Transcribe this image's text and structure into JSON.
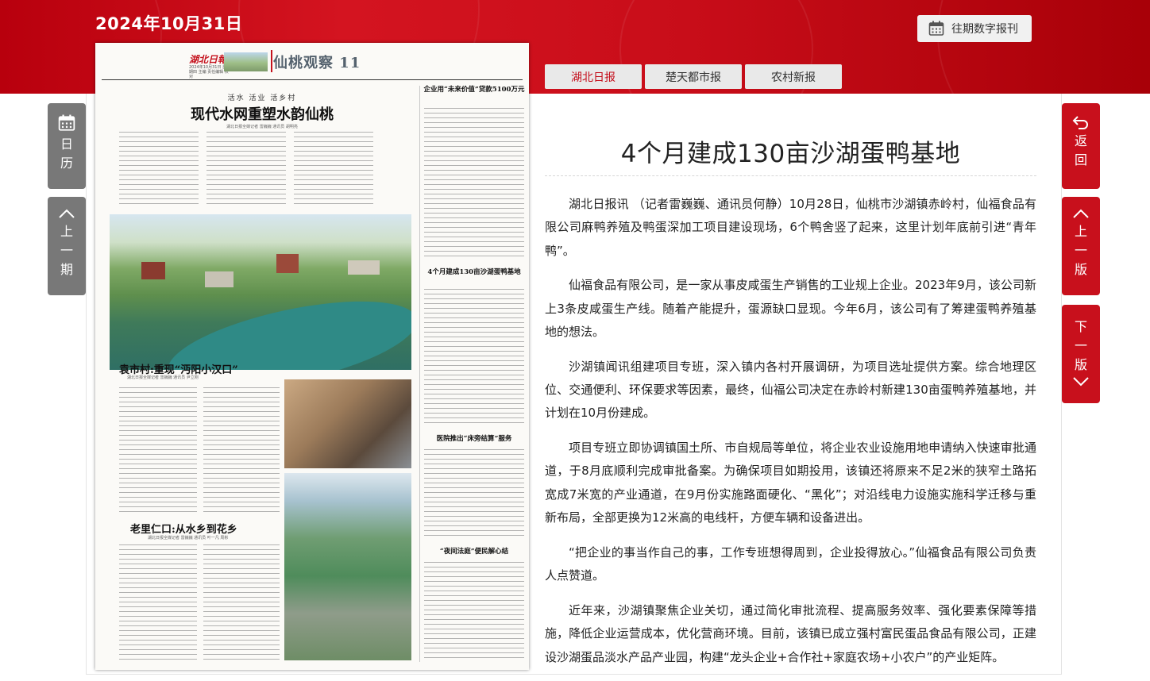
{
  "header": {
    "date": "2024年10月31日",
    "archive_button": "往期数字报刊"
  },
  "papers": [
    {
      "label": "湖北日报",
      "active": true
    },
    {
      "label": "楚天都市报",
      "active": false
    },
    {
      "label": "农村新报",
      "active": false
    }
  ],
  "nav": {
    "calendar": [
      "日",
      "历"
    ],
    "prev_issue": [
      "上",
      "一",
      "期"
    ],
    "prev_page": [
      "上",
      "一",
      "版"
    ],
    "next_page": [
      "下",
      "一",
      "版"
    ]
  },
  "newspaper": {
    "logo": "湖北日報",
    "meta": "2024年10月31日 星期四 主编 责任编辑 校对",
    "section": "仙桃观察 11",
    "kicker": "活水 活业 活乡村",
    "headline": "现代水网重塑水韵仙桃",
    "byline": "湖北日报全媒记者 雷巍巍 通讯员 胡明亮",
    "sub1": "袁市村:重现“沔阳小汉口”",
    "sub1_byline": "湖北日报全媒记者 雷巍巍 通讯员 尹立刚",
    "sub2": "老里仁口:从水乡到花乡",
    "sub2_byline": "湖北日报全媒记者 雷巍巍 通讯员 叶一凡 周彬",
    "right_col": [
      {
        "title": "企业用“未来价值”贷款5100万元"
      },
      {
        "title": "4个月建成130亩沙湖蛋鸭基地"
      },
      {
        "title": "医院推出“床旁结算”服务"
      },
      {
        "title": "“夜间法庭”便民解心结"
      }
    ]
  },
  "article": {
    "title": "4个月建成130亩沙湖蛋鸭基地",
    "paragraphs": [
      "湖北日报讯 （记者雷巍巍、通讯员何静）10月28日，仙桃市沙湖镇赤岭村，仙福食品有限公司麻鸭养殖及鸭蛋深加工项目建设现场，6个鸭舍竖了起来，这里计划年底前引进“青年鸭”。",
      "仙福食品有限公司，是一家从事皮咸蛋生产销售的工业规上企业。2023年9月，该公司新上3条皮咸蛋生产线。随着产能提升，蛋源缺口显现。今年6月，该公司有了筹建蛋鸭养殖基地的想法。",
      "沙湖镇闻讯组建项目专班，深入镇内各村开展调研，为项目选址提供方案。综合地理区位、交通便利、环保要求等因素，最终，仙福公司决定在赤岭村新建130亩蛋鸭养殖基地，并计划在10月份建成。",
      "项目专班立即协调镇国土所、市自规局等单位，将企业农业设施用地申请纳入快速审批通道，于8月底顺利完成审批备案。为确保项目如期投用，该镇还将原来不足2米的狭窄土路拓宽成7米宽的产业通道，在9月份实施路面硬化、“黑化”；对沿线电力设施实施科学迁移与重新布局，全部更换为12米高的电线杆，方便车辆和设备进出。",
      "“把企业的事当作自己的事，工作专班想得周到，企业投得放心。”仙福食品有限公司负责人点赞道。",
      "近年来，沙湖镇聚焦企业关切，通过简化审批流程、提高服务效率、强化要素保障等措施，降低企业运营成本，优化营商环境。目前，该镇已成立强村富民蛋品食品有限公司，正建设沙湖蛋品淡水产品产业园，构建“龙头企业+合作社+家庭农场+小农户”的产业矩阵。"
    ]
  },
  "colors": {
    "brand_red": "#c8101c",
    "side_gray": "#787878"
  }
}
